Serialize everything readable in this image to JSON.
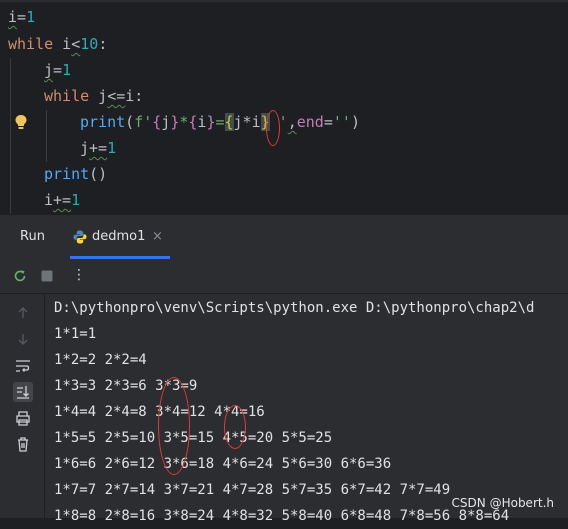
{
  "editor": {
    "line1": {
      "var": "i",
      "op": "=",
      "num": "1"
    },
    "line2": {
      "kw": "while",
      "var": " i",
      "op": "<",
      "num": "10",
      "colon": ":"
    },
    "line3": {
      "var": "j",
      "op": "=",
      "num": "1"
    },
    "line4": {
      "kw": "while",
      "var": " j",
      "op": "<=",
      "rest": "i:"
    },
    "line5": {
      "fn": "print",
      "open": "(",
      "fprefix": "f'",
      "b1o": "{",
      "b1v": "j",
      "b1c": "}",
      "mid1": "*",
      "b2o": "{",
      "b2v": "i",
      "b2c": "}",
      "mid2": "=",
      "b3o": "{",
      "b3v": "j*i",
      "b3c": "}",
      "quote": " '",
      "comma": ",",
      "kwarg": "end",
      "eq": "=",
      "endstr": "''",
      "close": ")"
    },
    "line6": {
      "var": "j",
      "op": "+=",
      "num": "1"
    },
    "line7": {
      "fn": "print",
      "parens": "()"
    },
    "line8": {
      "var": "i",
      "op": "+=",
      "num": "1"
    }
  },
  "run_panel": {
    "title": "Run",
    "tab_label": "dedmo1",
    "tab_close": "×",
    "more_glyph": "⋮"
  },
  "console": {
    "lines": [
      "D:\\pythonpro\\venv\\Scripts\\python.exe D:\\pythonpro\\chap2\\d",
      "1*1=1",
      "1*2=2 2*2=4",
      "1*3=3 2*3=6 3*3=9",
      "1*4=4 2*4=8 3*4=12 4*4=16",
      "1*5=5 2*5=10 3*5=15 4*5=20 5*5=25",
      "1*6=6 2*6=12 3*6=18 4*6=24 5*6=30 6*6=36",
      "1*7=7 2*7=14 3*7=21 4*7=28 5*7=35 6*7=42 7*7=49",
      "1*8=8 2*8=16 3*8=24 4*8=32 5*8=40 6*8=48 7*8=56 8*8=64"
    ]
  },
  "watermark": "CSDN @Hobert.h",
  "colors": {
    "editor_bg": "#1e1f22",
    "panel_bg": "#2b2d30",
    "keyword": "#cf8e6d",
    "number": "#2aacb8",
    "function": "#56a8f5",
    "string": "#6aab73",
    "annotation": "#e03a3a",
    "tab_underline": "#3574f0"
  },
  "icons": [
    "lightbulb-icon",
    "python-file-icon",
    "rerun-icon",
    "stop-icon",
    "more-icon",
    "scroll-up-icon",
    "scroll-down-icon",
    "soft-wrap-icon",
    "scroll-to-end-icon",
    "print-icon",
    "trash-icon"
  ]
}
